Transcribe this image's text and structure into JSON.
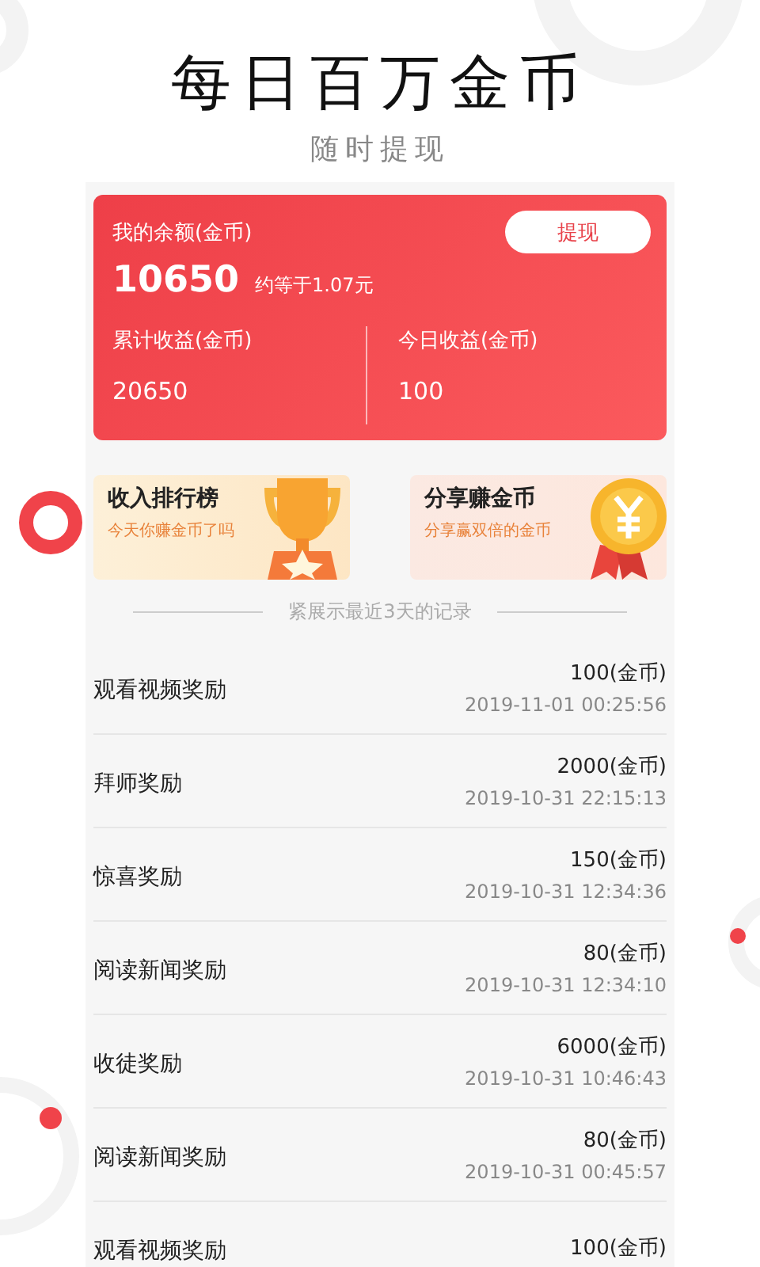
{
  "headline": {
    "title": "每日百万金币",
    "subtitle": "随时提现"
  },
  "balance_card": {
    "label": "我的余额(金币)",
    "amount": "10650",
    "equivalent": "约等于1.07元",
    "withdraw_button": "提现",
    "stats": [
      {
        "label": "累计收益(金币)",
        "value": "20650"
      },
      {
        "label": "今日收益(金币)",
        "value": "100"
      }
    ]
  },
  "promos": [
    {
      "kind": "trophy",
      "title": "收入排行榜",
      "subtitle": "今天你赚金币了吗"
    },
    {
      "kind": "coin",
      "title": "分享赚金币",
      "subtitle": "分享赢双倍的金币"
    }
  ],
  "records_note": "紧展示最近3天的记录",
  "records": [
    {
      "title": "观看视频奖励",
      "amount": "100(金币)",
      "time": "2019-11-01 00:25:56"
    },
    {
      "title": "拜师奖励",
      "amount": "2000(金币)",
      "time": "2019-10-31 22:15:13"
    },
    {
      "title": "惊喜奖励",
      "amount": "150(金币)",
      "time": "2019-10-31 12:34:36"
    },
    {
      "title": "阅读新闻奖励",
      "amount": "80(金币)",
      "time": "2019-10-31 12:34:10"
    },
    {
      "title": "收徒奖励",
      "amount": "6000(金币)",
      "time": "2019-10-31 10:46:43"
    },
    {
      "title": "阅读新闻奖励",
      "amount": "80(金币)",
      "time": "2019-10-31 00:45:57"
    },
    {
      "title": "观看视频奖励",
      "amount": "100(金币)"
    }
  ]
}
